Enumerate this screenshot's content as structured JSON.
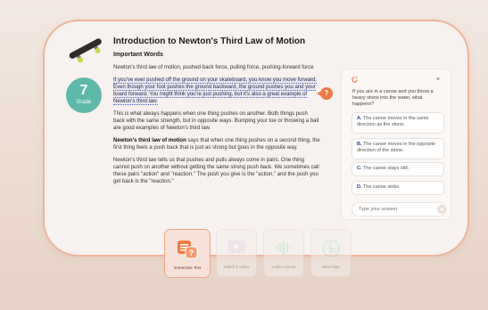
{
  "lesson": {
    "title": "Introduction to Newton's Third Law of Motion",
    "subtitle": "Important Words",
    "important_words": "Newton's third law of motion, pushed-back force, pulling force, pushing-forward force",
    "grade": {
      "number": "7",
      "label": "Grade"
    },
    "paragraphs": [
      {
        "highlight": "If you've ever pushed off the ground on your skateboard, you know you move forward. Even though your foot pushes the ground backward, the ground pushes you and your board forward. You might think you're just pushing, but it's also a great example of Newton's third law."
      },
      {
        "text": "This is what always happens when one thing pushes on another. Both things push back with the same strength, but in opposite ways. Bumping your toe or throwing a ball are good examples of Newton's third law."
      },
      {
        "bold": "Newton's third law of motion",
        "text": " says that when one thing pushes on a second thing, the first thing feels a push back that is just as strong but goes in the opposite way."
      },
      {
        "text": "Newton's third law tells us that pushes and pulls always come in pairs. One thing cannot push on another without getting the same strong push back. We sometimes call these pairs \"action\" and \"reaction.\" The push you give is the \"action,\" and the push you get back is the \"reaction.\""
      }
    ]
  },
  "help_badge": {
    "label": "?"
  },
  "quiz": {
    "close_label": "×",
    "question": "If you are in a canoe and you throw a heavy stone into the water, what happens?",
    "options": [
      {
        "letter": "A.",
        "text": "The canoe moves in the same direction as the stone."
      },
      {
        "letter": "B.",
        "text": "The canoe moves in the opposite direction of the stone."
      },
      {
        "letter": "C.",
        "text": "The canoe stays still."
      },
      {
        "letter": "D.",
        "text": "The canoe sinks."
      }
    ],
    "answer_placeholder": "Type your answer",
    "send_icon": "arrow-right-icon"
  },
  "toolbar": {
    "tools": [
      {
        "label": "Immersive Text",
        "icon": "immersive-text-icon",
        "active": true
      },
      {
        "label": "Watch a Video",
        "icon": "video-icon",
        "active": false
      },
      {
        "label": "Audio Lesson",
        "icon": "audio-wave-icon",
        "active": false
      },
      {
        "label": "Mind Map",
        "icon": "mind-map-icon",
        "active": false
      }
    ]
  },
  "colors": {
    "accent": "#ef7a45",
    "grade_badge": "#5fb9aa",
    "card_border": "#f0b39a",
    "highlight_underline": "#4a63c8"
  }
}
